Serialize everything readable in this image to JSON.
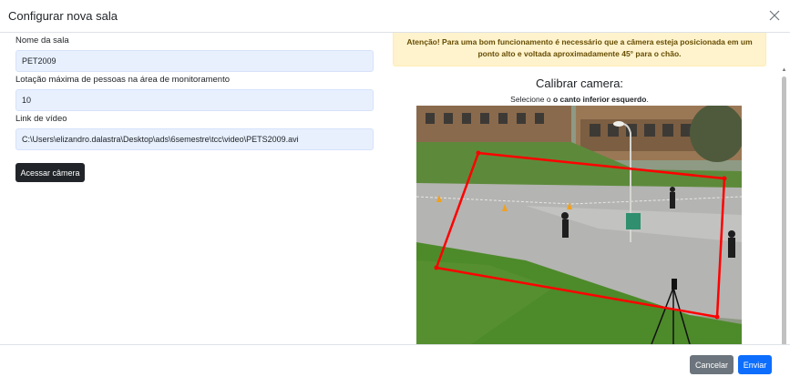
{
  "modal": {
    "title": "Configurar nova sala"
  },
  "form": {
    "room_name_label": "Nome da sala",
    "room_name_value": "PET2009",
    "max_people_label": "Lotação máxima de pessoas na área de monitoramento",
    "max_people_value": "10",
    "video_link_label": "Link de vídeo",
    "video_link_value": "C:\\Users\\elizandro.dalastra\\Desktop\\ads\\6semestre\\tcc\\video\\PETS2009.avi",
    "access_camera_label": "Acessar câmera"
  },
  "calibration": {
    "alert_text": "Atenção! Para uma bom funcionamento é necessário que a câmera esteja posicionada em um ponto alto e voltada aproximadamente 45° para o chão.",
    "title": "Calibrar camera:",
    "instruction_prefix": "Selecione o ",
    "instruction_bold": "o canto inferior esquerdo",
    "instruction_suffix": "."
  },
  "footer": {
    "cancel_label": "Cancelar",
    "submit_label": "Enviar"
  },
  "colors": {
    "alert_bg": "#fff3cd",
    "alert_text": "#664d03",
    "input_bg": "#e8f0fe",
    "primary": "#0d6efd",
    "secondary": "#6c757d",
    "dark": "#212529",
    "calibration_polygon": "#ff0000"
  },
  "icons": {
    "close": "close-icon"
  }
}
